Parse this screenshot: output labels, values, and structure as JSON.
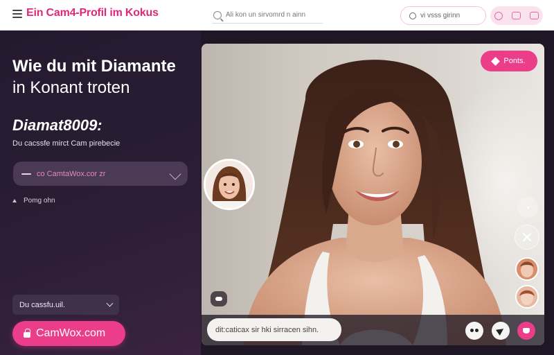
{
  "header": {
    "title": "Ein Cam4-Profil im Kokus",
    "search_placeholder": "Ali kon  un sirvomrd n ainn",
    "pill_label": "vi vsss girinn"
  },
  "hero": {
    "headline_line1": "Wie du mit Diamante",
    "headline_line2": "in Konant troten",
    "username": "Diamat8009:",
    "subline": "Du cacssfe mirct Cam  pirebecie"
  },
  "url_field": {
    "value": "co CamtaWox.cor zr"
  },
  "small_link": {
    "label": "Pomg ohn"
  },
  "select": {
    "selected": "Du cassfu.uil."
  },
  "cta": {
    "label": "CamWox.com"
  },
  "stage": {
    "points_label": "Ponts."
  },
  "chat": {
    "input_value": "dit:caticax sir hki sirracen sihn."
  },
  "colors": {
    "accent": "#ec3d8a",
    "brand_text": "#e0287a",
    "panel_bg": "#241a2e"
  }
}
